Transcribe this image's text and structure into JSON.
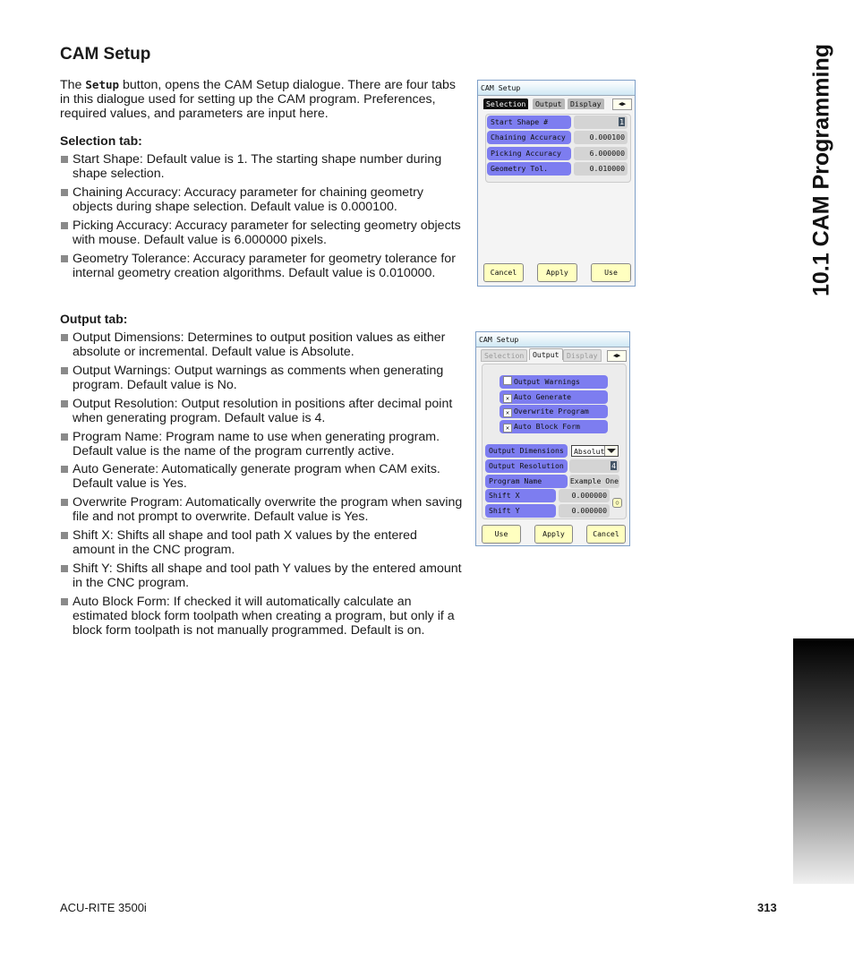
{
  "section_title": "CAM Setup",
  "intro": {
    "pre": "The ",
    "button_word": "Setup",
    "post": " button, opens the CAM Setup dialogue.  There are four tabs in this dialogue used for setting up the CAM program.  Preferences, required values, and parameters are input here."
  },
  "selection_heading": "Selection tab:",
  "selection_bullets": [
    "Start Shape:  Default value is 1.  The starting shape number during shape selection.",
    "Chaining Accuracy:  Accuracy parameter for chaining geometry objects during shape selection. Default value is 0.000100.",
    "Picking Accuracy:  Accuracy parameter for selecting geometry objects with mouse. Default value is 6.000000 pixels.",
    "Geometry Tolerance:  Accuracy parameter for geometry tolerance for internal geometry creation algorithms. Default value is 0.010000."
  ],
  "output_heading": "Output tab:",
  "output_bullets": [
    "Output Dimensions:  Determines to output position values as either absolute or incremental. Default value is Absolute.",
    "Output Warnings:  Output warnings as comments when generating program. Default value is No.",
    "Output Resolution:  Output resolution in positions after decimal point when generating program. Default value is 4.",
    "Program Name:  Program name to use when generating program. Default value is the name of the program currently active.",
    "Auto Generate:  Automatically generate program when CAM exits. Default value is Yes.",
    "Overwrite Program:  Automatically overwrite the program when saving file and not prompt to overwrite. Default value is Yes.",
    "Shift X:  Shifts all shape and tool path X values by the entered amount in the CNC program.",
    "Shift Y:  Shifts all shape and tool path Y values by the entered amount in the CNC program.",
    "Auto Block Form: If checked it will automatically calculate an estimated block form toolpath when creating a program, but  only if a block form toolpath is not manually programmed. Default is on."
  ],
  "dialog1": {
    "title": "CAM Setup",
    "tabs": [
      "Selection",
      "Output",
      "Display"
    ],
    "active_tab": "Selection",
    "rows": [
      {
        "label": "Start Shape #",
        "value": "1"
      },
      {
        "label": "Chaining Accuracy",
        "value": "0.000100"
      },
      {
        "label": "Picking Accuracy",
        "value": "6.000000"
      },
      {
        "label": "Geometry Tol.",
        "value": "0.010000"
      }
    ],
    "buttons": [
      "Cancel",
      "Apply",
      "Use"
    ]
  },
  "dialog2": {
    "title": "CAM Setup",
    "tabs": [
      "Selection",
      "Output",
      "Display"
    ],
    "active_tab": "Output",
    "checks": [
      {
        "label": "Output Warnings",
        "checked": false,
        "mark": ""
      },
      {
        "label": "Auto Generate",
        "checked": true,
        "mark": "✕"
      },
      {
        "label": "Overwrite Program",
        "checked": true,
        "mark": "✕"
      },
      {
        "label": "Auto Block Form",
        "checked": true,
        "mark": "✕"
      }
    ],
    "rows": [
      {
        "label": "Output Dimensions",
        "value": "Absolut"
      },
      {
        "label": "Output Resolution",
        "value": "4"
      },
      {
        "label": "Program Name",
        "value": "Example One"
      },
      {
        "label": "Shift X",
        "value": "0.000000"
      },
      {
        "label": "Shift Y",
        "value": "0.000000"
      }
    ],
    "buttons": [
      "Use",
      "Apply",
      "Cancel"
    ]
  },
  "side_title": "10.1 CAM Programming",
  "footer": {
    "product": "ACU-RITE 3500i",
    "page": "313"
  },
  "colors": {
    "label_blue": "#7d7df0",
    "button_yellow": "#ffffc0"
  }
}
